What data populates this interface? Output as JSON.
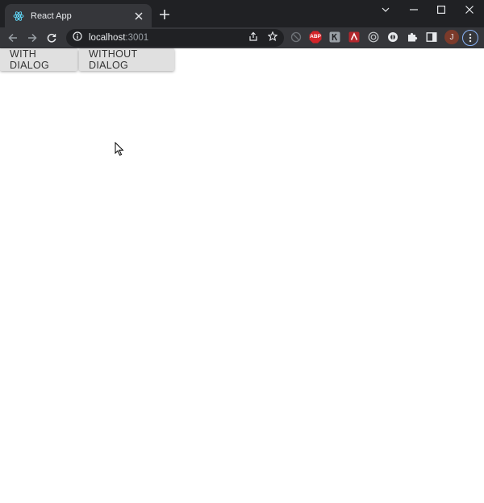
{
  "browser": {
    "tab_title": "React App",
    "url_host": "localhost",
    "url_port": ":3001",
    "profile_initial": "J",
    "abp_label": "ABP"
  },
  "page": {
    "buttons": [
      {
        "label": "WITH DIALOG"
      },
      {
        "label": "WITHOUT DIALOG"
      }
    ]
  },
  "colors": {
    "chrome_dark": "#202124",
    "chrome_toolbar": "#35363a",
    "button_bg": "#e0e0e0",
    "abp_red": "#d4252a",
    "profile_bg": "#7b3a2a"
  }
}
